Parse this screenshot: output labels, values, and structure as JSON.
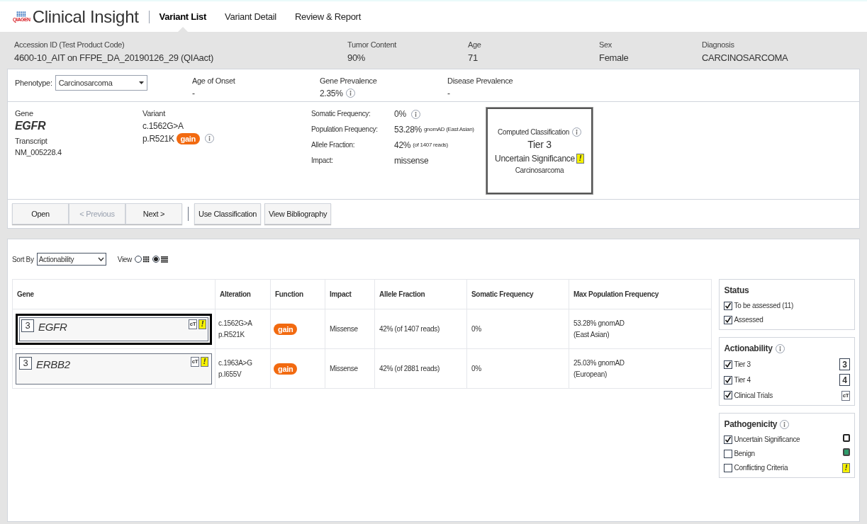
{
  "app": {
    "brand": "QIAGEN",
    "title": "Clinical Insight"
  },
  "tabs": [
    {
      "label": "Variant List",
      "selected": true
    },
    {
      "label": "Variant Detail",
      "selected": false
    },
    {
      "label": "Review & Report",
      "selected": false
    }
  ],
  "patient": [
    {
      "label": "Accession ID (Test Product Code)",
      "value": "4600-10_AIT on FFPE_DA_20190126_29  (QIAact)"
    },
    {
      "label": "Tumor Content",
      "value": "90%"
    },
    {
      "label": "Age",
      "value": "71"
    },
    {
      "label": "Sex",
      "value": "Female"
    },
    {
      "label": "Diagnosis",
      "value": "CARCINOSARCOMA"
    }
  ],
  "phenotype": {
    "label": "Phenotype:",
    "value": "Carcinosarcoma",
    "fields": [
      {
        "label": "Age of Onset",
        "value": "-",
        "info": false
      },
      {
        "label": "Gene Prevalence",
        "value": "2.35%",
        "info": true
      },
      {
        "label": "Disease Prevalence",
        "value": "-",
        "info": false
      }
    ]
  },
  "variant": {
    "gene_label": "Gene",
    "gene": "EGFR",
    "transcript_label": "Transcript",
    "transcript": "NM_005228.4",
    "variant_label": "Variant",
    "cdna": "c.1562G>A",
    "protein": "p.R521K",
    "function": "gain",
    "stats": [
      {
        "label": "Somatic Frequency:",
        "value": "0%",
        "info": true
      },
      {
        "label": "Population Frequency:",
        "value": "53.28%",
        "note": "gnomAD (East Asian)",
        "info": false
      },
      {
        "label": "Allele Fraction:",
        "value": "42%",
        "note": "(of 1407 reads)",
        "info": false
      },
      {
        "label": "Impact:",
        "value": "missense",
        "info": false
      }
    ],
    "classification": {
      "title": "Computed Classification",
      "tier": "Tier 3",
      "significance": "Uncertain Significance",
      "flag": "!",
      "disease": "Carcinosarcoma"
    }
  },
  "actions": [
    {
      "label": "Open",
      "disabled": false
    },
    {
      "label": "< Previous",
      "disabled": true
    },
    {
      "label": "Next >",
      "disabled": false
    },
    {
      "label": "Use Classification",
      "disabled": false
    },
    {
      "label": "View Bibliography",
      "disabled": false
    }
  ],
  "sort": {
    "label": "Sort By",
    "value": "Actionability"
  },
  "view": {
    "label": "View",
    "options": [
      {
        "kind": "grid",
        "selected": false
      },
      {
        "kind": "list",
        "selected": true
      }
    ]
  },
  "table": {
    "columns": [
      "Gene",
      "Alteration",
      "Function",
      "Impact",
      "Allele Fraction",
      "Somatic Frequency",
      "Max Population Frequency"
    ],
    "rows": [
      {
        "selected": true,
        "rank": "3",
        "gene": "EGFR",
        "trial": "cT",
        "flag": "!",
        "cdna": "c.1562G>A",
        "protein": "p.R521K",
        "function": "gain",
        "impact": "Missense",
        "allele": "42% (of 1407 reads)",
        "somatic": "0%",
        "pop": "53.28% gnomAD",
        "pop_note": "(East Asian)"
      },
      {
        "selected": false,
        "rank": "3",
        "gene": "ERBB2",
        "trial": "cT",
        "flag": "!",
        "cdna": "c.1963A>G",
        "protein": "p.I655V",
        "function": "gain",
        "impact": "Missense",
        "allele": "42% (of 2881 reads)",
        "somatic": "0%",
        "pop": "25.03% gnomAD",
        "pop_note": "(European)"
      }
    ]
  },
  "filters": [
    {
      "title": "Status",
      "info": false,
      "items": [
        {
          "label": "To be assessed (11)",
          "checked": true
        },
        {
          "label": "Assessed",
          "checked": true
        }
      ]
    },
    {
      "title": "Actionability",
      "info": true,
      "items": [
        {
          "label": "Tier 3",
          "checked": true,
          "kind": "tier",
          "mark": "3"
        },
        {
          "label": "Tier 4",
          "checked": true,
          "kind": "tier",
          "mark": "4"
        },
        {
          "label": "Clinical Trials",
          "checked": true,
          "kind": "trial",
          "mark": "cT"
        }
      ]
    },
    {
      "title": "Pathogenicity",
      "info": true,
      "items": [
        {
          "label": "Uncertain Significance",
          "checked": true,
          "kind": "square"
        },
        {
          "label": "Benign",
          "checked": false,
          "kind": "benign"
        },
        {
          "label": "Conflicting Criteria",
          "checked": false,
          "kind": "flag",
          "mark": "!"
        }
      ]
    }
  ]
}
